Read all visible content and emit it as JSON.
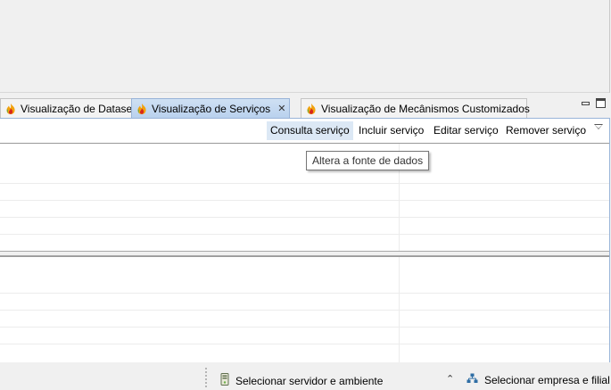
{
  "tabs": [
    {
      "label": "Visualização de Dataset",
      "active": false
    },
    {
      "label": "Visualização de Serviços",
      "active": true,
      "closable": true
    },
    {
      "label": "Visualização de Mecânismos Customizados",
      "active": false
    }
  ],
  "tab_icon": "flame-icon",
  "toolbar": {
    "consulta": "Consulta serviço",
    "incluir": "Incluir serviço",
    "editar": "Editar serviço",
    "remover": "Remover serviço"
  },
  "tooltip": "Altera a fonte de dados",
  "status": {
    "server": "Selecionar servidor e ambiente",
    "company": "Selecionar empresa e filial"
  },
  "colors": {
    "active_tab": "#b9d1ee",
    "hover_button": "#dce8f5",
    "panel_border": "#99b4d8"
  }
}
